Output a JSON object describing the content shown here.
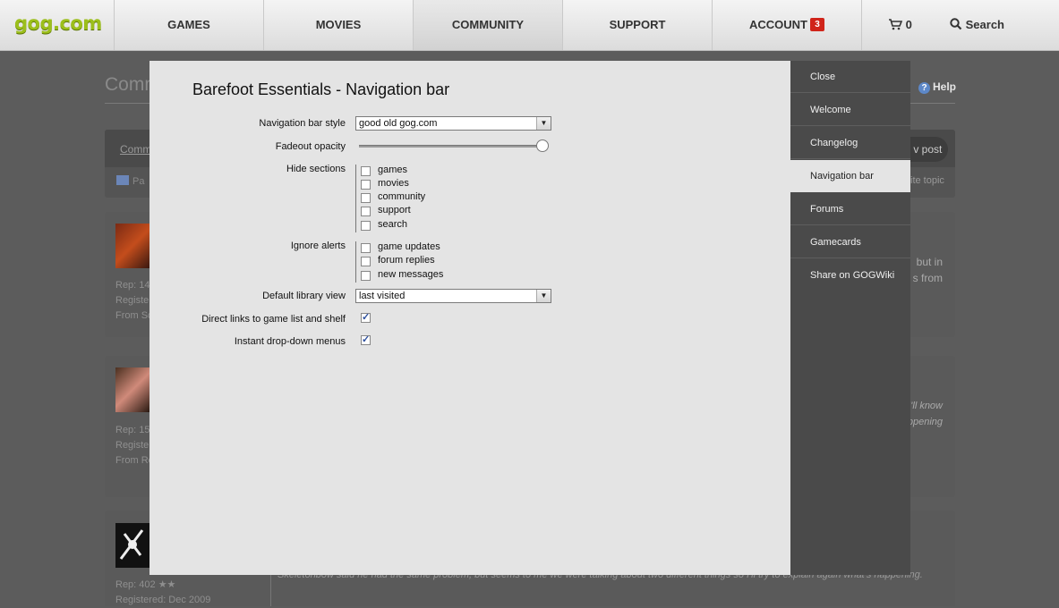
{
  "nav": {
    "logo": "gog.com",
    "items": [
      "GAMES",
      "MOVIES",
      "COMMUNITY",
      "SUPPORT",
      "ACCOUNT"
    ],
    "active": "COMMUNITY",
    "account_badge": "3",
    "cart_count": "0",
    "search_label": "Search"
  },
  "background": {
    "title": "Comm",
    "help": "Help",
    "breadcrumb": "Comm",
    "new_post": "v post",
    "pa": "Pa",
    "write_topic": "ite topic",
    "posts": [
      {
        "rep": "Rep: 14",
        "registered": "Register",
        "from": "From Sc",
        "text_lines": [
          "but in",
          "s  from"
        ]
      },
      {
        "rep": "Rep: 15",
        "registered": "Register",
        "from": "From Re",
        "text_lines": [
          "I'll  know",
          "ppening"
        ]
      },
      {
        "rep": "Rep: 402 ★★",
        "registered": "Registered: Dec 2009",
        "from": "",
        "text_lines": [
          "Skeletonbow said he had the same problem, but seems to me we were talking about two different things so I'll try to explain again what's happening."
        ]
      }
    ]
  },
  "modal": {
    "title": "Barefoot Essentials - Navigation bar",
    "nav_style_label": "Navigation bar style",
    "nav_style_value": "good old gog.com",
    "fadeout_label": "Fadeout opacity",
    "fadeout_value": 1.0,
    "hide_sections_label": "Hide sections",
    "hide_sections": [
      {
        "label": "games",
        "checked": false
      },
      {
        "label": "movies",
        "checked": false
      },
      {
        "label": "community",
        "checked": false
      },
      {
        "label": "support",
        "checked": false
      },
      {
        "label": "search",
        "checked": false
      }
    ],
    "ignore_alerts_label": "Ignore alerts",
    "ignore_alerts": [
      {
        "label": "game updates",
        "checked": false
      },
      {
        "label": "forum replies",
        "checked": false
      },
      {
        "label": "new messages",
        "checked": false
      }
    ],
    "library_label": "Default library view",
    "library_value": "last visited",
    "direct_links_label": "Direct links to game list and shelf",
    "direct_links_checked": true,
    "instant_menus_label": "Instant drop-down menus",
    "instant_menus_checked": true
  },
  "sidebar": {
    "items": [
      "Close",
      "Welcome",
      "Changelog",
      "Navigation bar",
      "Forums",
      "Gamecards",
      "Share on GOGWiki"
    ],
    "active": "Navigation bar"
  },
  "colors": {
    "logo_green": "#9cbf1c",
    "badge_red": "#d0241a",
    "sidebar_bg": "#4a4a4a",
    "modal_bg": "#e4e4e4"
  }
}
